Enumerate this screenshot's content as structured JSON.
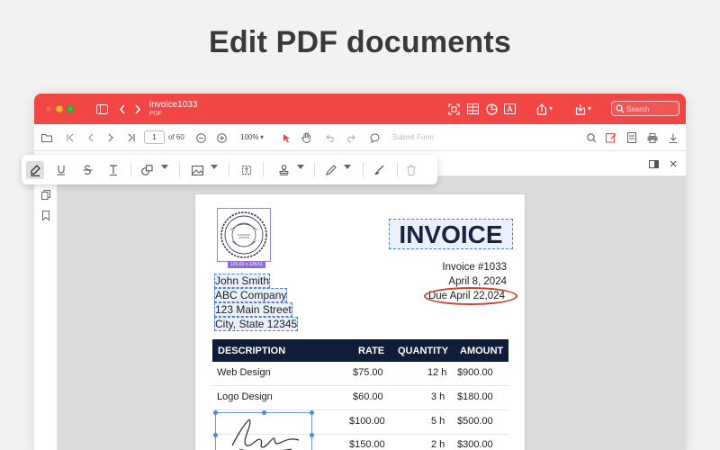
{
  "headline": "Edit PDF documents",
  "window": {
    "title": "invoice1033",
    "subtitle": "PDF",
    "search_placeholder": "Search"
  },
  "toolbar": {
    "page_current": "1",
    "page_total": "of 60",
    "zoom": "100%",
    "submit_form": "Submit Form"
  },
  "invoice": {
    "title": "INVOICE",
    "number": "Invoice #1033",
    "date": "April 8, 2024",
    "due": "Due April 22,024",
    "stamp_size": "123.63 x 128.61",
    "billing": [
      "John Smith",
      "ABC Company",
      "123 Main Street",
      "City, State 12345"
    ],
    "table": {
      "headers": [
        "DESCRIPTION",
        "RATE",
        "QUANTITY",
        "AMOUNT"
      ],
      "rows": [
        {
          "description": "Web Design",
          "rate": "$75.00",
          "quantity": "12 h",
          "amount": "$900.00"
        },
        {
          "description": "Logo Design",
          "rate": "$60.00",
          "quantity": "3 h",
          "amount": "$180.00"
        },
        {
          "description": "",
          "rate": "$100.00",
          "quantity": "5 h",
          "amount": "$500.00"
        },
        {
          "description": "",
          "rate": "$150.00",
          "quantity": "2 h",
          "amount": "$300.00"
        }
      ]
    }
  },
  "colors": {
    "accent": "#f24545",
    "table_header": "#0f1c3a",
    "annotation_oval": "#c8442a",
    "selection": "#4a7fd4",
    "stamp_selection": "#8e6ae0"
  },
  "icons": {
    "toolbar": [
      "folder-icon",
      "first-page-icon",
      "prev-page-icon",
      "next-page-icon",
      "last-page-icon",
      "zoom-out-icon",
      "zoom-in-icon",
      "select-cursor-icon",
      "hand-icon",
      "undo-icon",
      "redo-icon",
      "comment-icon",
      "search-icon",
      "markup-icon",
      "form-icon",
      "print-icon",
      "download-icon"
    ],
    "floating": [
      "highlighter-icon",
      "underline-icon",
      "strikethrough-icon",
      "text-icon",
      "shapes-icon",
      "image-icon",
      "text-box-icon",
      "stamp-icon",
      "pen-icon",
      "brush-icon",
      "trash-icon"
    ]
  }
}
